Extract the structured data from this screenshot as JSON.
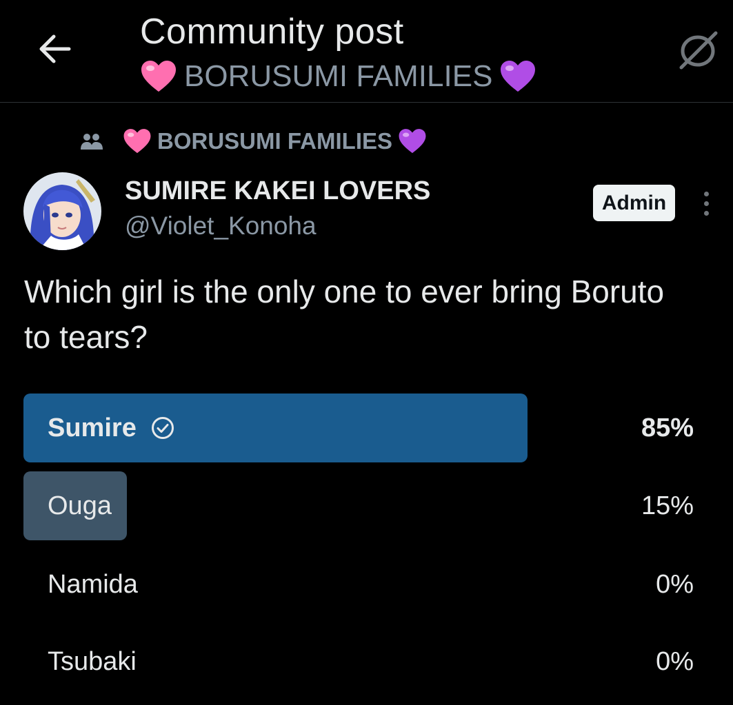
{
  "header": {
    "title": "Community post",
    "subtitle": "BORUSUMI FAMILIES",
    "back_icon": "arrow-left-icon",
    "right_icon": "spoiler-slash-icon"
  },
  "community": {
    "name": "BORUSUMI FAMILIES",
    "icon": "people-icon",
    "heart_left_color": "#ff6fb0",
    "heart_right_color": "#b04de6"
  },
  "author": {
    "name": "SUMIRE KAKEI LOVERS",
    "handle": "@Violet_Konoha",
    "badge": "Admin"
  },
  "post": {
    "text": "Which girl is the only one to ever bring Boruto to tears?"
  },
  "poll": {
    "options": [
      {
        "label": "Sumire",
        "percent_label": "85%",
        "share": 0.85,
        "winner": true,
        "check_icon": "check-circle-icon",
        "bar_color": "#1a5c8f"
      },
      {
        "label": "Ouga",
        "percent_label": "15%",
        "share": 0.15,
        "winner": false,
        "bar_color": "#3e5568"
      },
      {
        "label": "Namida",
        "percent_label": "0%",
        "share": 0.0,
        "winner": false
      },
      {
        "label": "Tsubaki",
        "percent_label": "0%",
        "share": 0.0,
        "winner": false
      }
    ]
  },
  "colors": {
    "background": "#000000",
    "text_primary": "#e7e9ea",
    "text_secondary": "#8b98a5",
    "winner_bar": "#1a5c8f",
    "loser_bar": "#3e5568"
  }
}
